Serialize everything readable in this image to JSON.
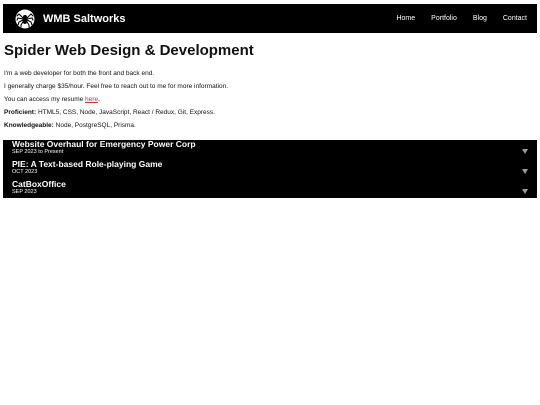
{
  "header": {
    "brand": "WMB Saltworks",
    "logo": "spider-logo",
    "nav": [
      "Home",
      "Portfolio",
      "Blog",
      "Contact"
    ]
  },
  "main": {
    "title": "Spider Web Design & Development",
    "intro": "I'm a web developer for both the front and back end.",
    "rate": "I generally charge $35/hour. Feel free to reach out to me for more information.",
    "resume_prefix": "You can access my resume ",
    "resume_link": "here",
    "resume_suffix": ".",
    "proficient_label": "Proficient:",
    "proficient_value": " HTML5, CSS, Node, JavaScript, React / Redux, Git, Express.",
    "knowledgeable_label": "Knowledgeable:",
    "knowledgeable_value": " Node, PostgreSQL, Prisma."
  },
  "projects": [
    {
      "title": "Website Overhaul for Emergency Power Corp",
      "date": "SEP 2023 to Present"
    },
    {
      "title": "PIE: A Text-based Role-playing Game",
      "date": "OCT 2023"
    },
    {
      "title": "CatBoxOffice",
      "date": "SEP 2023"
    }
  ],
  "colors": {
    "nav_bg": "#000000",
    "link": "#c0392b",
    "caret": "#9a9a9a"
  },
  "icons": {
    "expand": "caret-down-icon"
  }
}
